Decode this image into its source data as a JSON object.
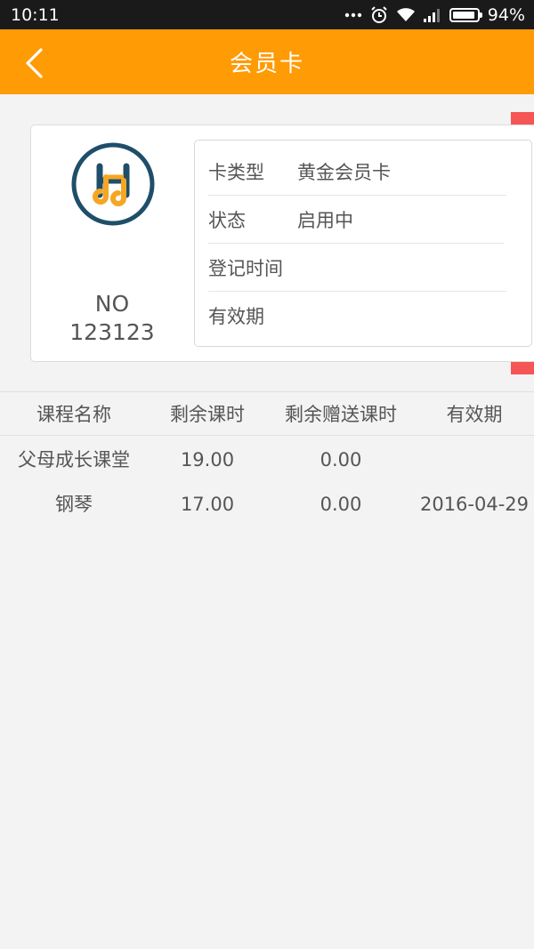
{
  "status_bar": {
    "time": "10:11",
    "battery_text": "94%",
    "battery_level": 0.94,
    "icons": [
      "more-icon",
      "alarm-icon",
      "wifi-icon",
      "signal-icon",
      "battery-icon"
    ]
  },
  "header": {
    "title": "会员卡",
    "back_icon": "chevron-left-icon",
    "color": "#ff9b05"
  },
  "card": {
    "number_prefix": "NO",
    "number": "123123",
    "logo_colors": {
      "ring": "#1f4e6a",
      "letter": "#f5a623"
    },
    "info": [
      {
        "label": "卡类型",
        "value": "黄金会员卡"
      },
      {
        "label": "状态",
        "value": "启用中"
      },
      {
        "label": "登记时间",
        "value": ""
      },
      {
        "label": "有效期",
        "value": ""
      }
    ],
    "side_tab_color": "#f65555"
  },
  "table": {
    "columns": [
      "课程名称",
      "剩余课时",
      "剩余赠送课时",
      "有效期"
    ],
    "rows": [
      [
        "父母成长课堂",
        "19.00",
        "0.00",
        ""
      ],
      [
        "钢琴",
        "17.00",
        "0.00",
        "2016-04-29"
      ]
    ]
  }
}
